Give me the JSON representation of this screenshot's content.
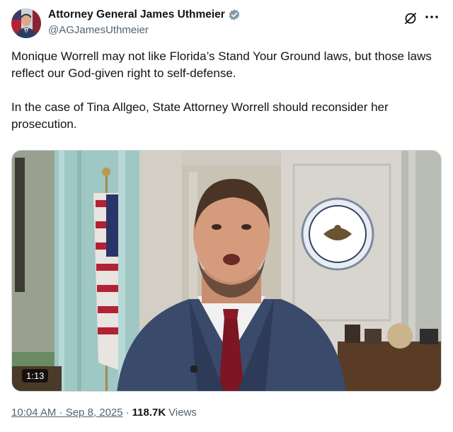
{
  "author": {
    "display_name": "Attorney General James Uthmeier",
    "handle": "@AGJamesUthmeier",
    "verified_badge_color": "#829aab"
  },
  "icons": {
    "grok": "grok-icon",
    "more": "more-icon",
    "verified": "verified-badge-icon"
  },
  "tweet": {
    "paragraphs": [
      "Monique Worrell may not like Florida’s Stand Your Ground laws, but those laws reflect our God-given right to self-defense.",
      "In the case of Tina Allgeo, State Attorney Worrell should reconsider her prosecution."
    ]
  },
  "video": {
    "duration": "1:13"
  },
  "meta": {
    "timestamp": "10:04 AM · Sep 8, 2025",
    "separator": "·",
    "views_count": "118.7K",
    "views_label": "Views"
  }
}
